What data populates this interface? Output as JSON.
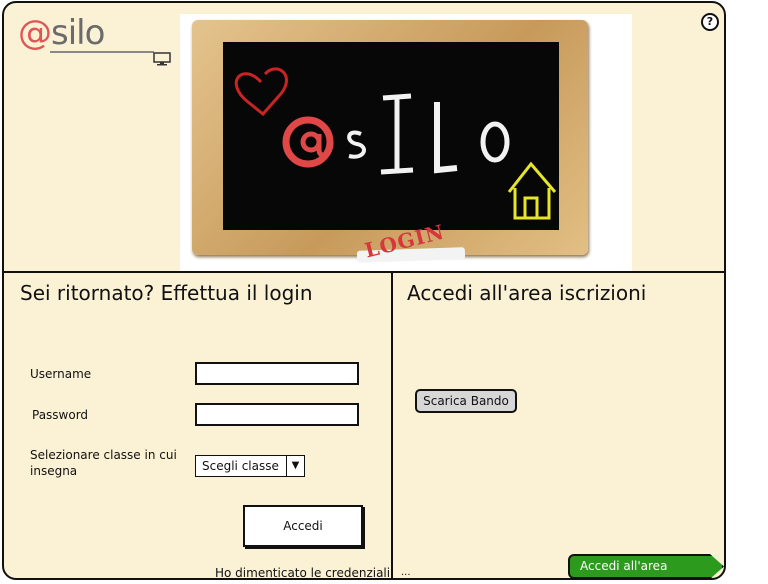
{
  "header": {
    "logo_at": "@",
    "logo_text": "silo",
    "help_label": "?",
    "chalkboard_login": "LOGIN"
  },
  "login_panel": {
    "title": "Sei ritornato? Effettua il login",
    "username_label": "Username",
    "username_value": "",
    "password_label": "Password",
    "password_value": "",
    "class_label_line1": "Selezionare classe in cui",
    "class_label_line2": "insegna",
    "class_select_value": "Scegli classe",
    "submit_label": "Accedi",
    "forgot_link": "Ho dimenticato le credenziali"
  },
  "enrollment_panel": {
    "title": "Accedi all'area iscrizioni",
    "download_button": "Scarica Bando",
    "ellipsis": "...",
    "enter_button": "Accedi all'area iscrizioni"
  },
  "colors": {
    "background": "#fbf2d6",
    "logo_accent": "#e05555",
    "cta_green": "#2c9a1d",
    "login_red": "#d6363c"
  },
  "icons": [
    "help-icon",
    "computer-icon",
    "dropdown-arrow-icon",
    "heart-doodle",
    "house-doodle"
  ]
}
